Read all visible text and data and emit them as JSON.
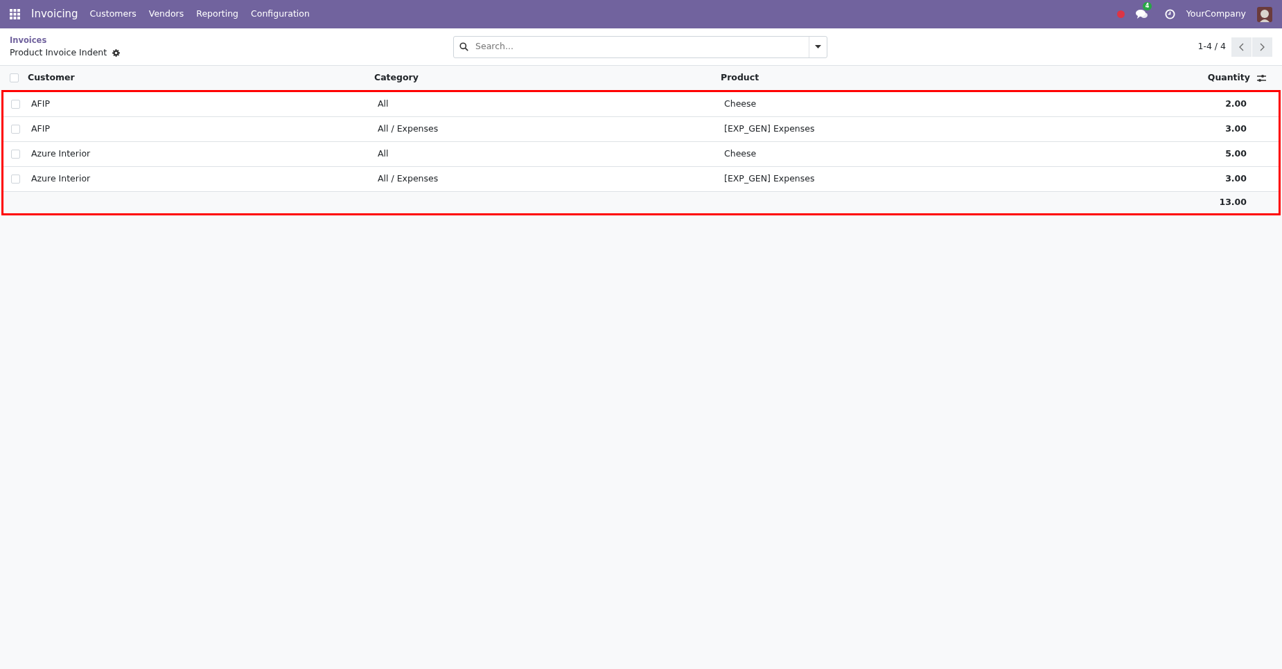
{
  "navbar": {
    "app": "Invoicing",
    "menus": [
      "Customers",
      "Vendors",
      "Reporting",
      "Configuration"
    ],
    "messages_count": "4",
    "company": "YourCompany"
  },
  "breadcrumb": {
    "parent": "Invoices",
    "current": "Product Invoice Indent"
  },
  "search": {
    "placeholder": "Search..."
  },
  "pager": {
    "value": "1-4 / 4"
  },
  "table": {
    "all_selected": false,
    "columns": [
      "Customer",
      "Category",
      "Product",
      "Quantity"
    ],
    "rows": [
      {
        "selected": false,
        "cells": [
          "AFIP",
          "All",
          "Cheese",
          "2.00"
        ]
      },
      {
        "selected": false,
        "cells": [
          "AFIP",
          "All / Expenses",
          "[EXP_GEN] Expenses",
          "3.00"
        ]
      },
      {
        "selected": false,
        "cells": [
          "Azure Interior",
          "All",
          "Cheese",
          "5.00"
        ]
      },
      {
        "selected": false,
        "cells": [
          "Azure Interior",
          "All / Expenses",
          "[EXP_GEN] Expenses",
          "3.00"
        ]
      }
    ],
    "total": "13.00"
  }
}
